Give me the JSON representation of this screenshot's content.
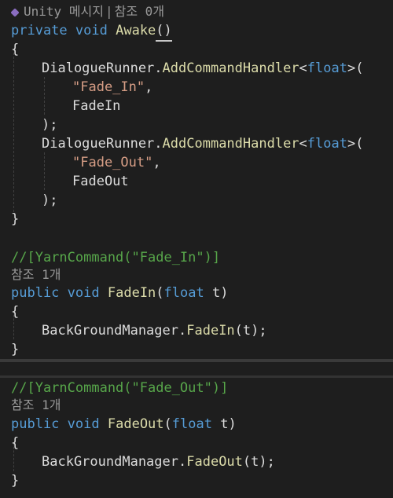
{
  "codelens_awake": {
    "unity_label": "Unity 메시지",
    "separator": "|",
    "refs": "참조 0개"
  },
  "awake_signature": {
    "kw_private": "private",
    "kw_void": "void",
    "name": "Awake",
    "parens": "()"
  },
  "brace_open": "{",
  "brace_close": "}",
  "block1": {
    "class": "DialogueRunner",
    "dot": ".",
    "method": "AddCommandHandler",
    "lt": "<",
    "type": "float",
    "gt_paren": ">(",
    "arg_string": "\"Fade_In\"",
    "comma": ",",
    "arg_handler": "FadeIn",
    "close": ");"
  },
  "block2": {
    "class": "DialogueRunner",
    "dot": ".",
    "method": "AddCommandHandler",
    "lt": "<",
    "type": "float",
    "gt_paren": ">(",
    "arg_string": "\"Fade_Out\"",
    "comma": ",",
    "arg_handler": "FadeOut",
    "close": ");"
  },
  "fadein": {
    "comment": "//[YarnCommand(\"Fade_In\")]",
    "refs": "참조 1개",
    "kw_public": "public",
    "kw_void": "void",
    "name": "FadeIn",
    "paren_open": "(",
    "param_type": "float",
    "param_name": " t)",
    "body_class": "BackGroundManager",
    "body_dot": ".",
    "body_method": "FadeIn",
    "body_args": "(t);"
  },
  "fadeout": {
    "comment": "//[YarnCommand(\"Fade_Out\")]",
    "refs": "참조 1개",
    "kw_public": "public",
    "kw_void": "void",
    "name": "FadeOut",
    "paren_open": "(",
    "param_type": "float",
    "param_name": " t)",
    "body_class": "BackGroundManager",
    "body_dot": ".",
    "body_method": "FadeOut",
    "body_args": "(t);"
  },
  "colors": {
    "background": "#1e1e1e",
    "keyword": "#569cd6",
    "method": "#dcdcaa",
    "string": "#d69d85",
    "comment": "#57a64a",
    "codelens": "#999999"
  }
}
